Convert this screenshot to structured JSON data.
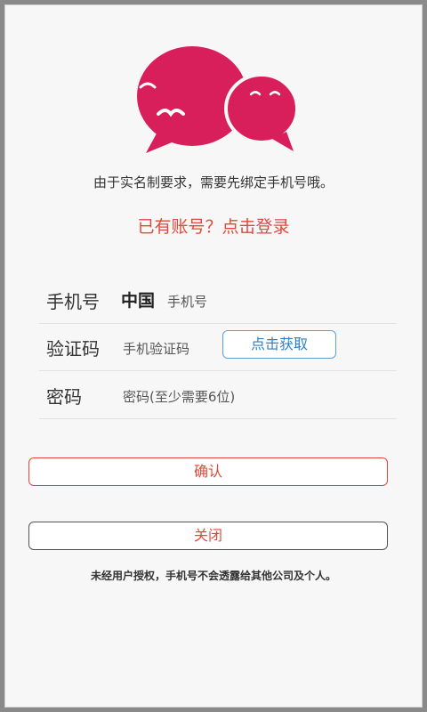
{
  "notice": "由于实名制要求，需要先绑定手机号哦。",
  "login_link": "已有账号？点击登录",
  "form": {
    "phone": {
      "label": "手机号",
      "country": "中国",
      "placeholder": "手机号"
    },
    "code": {
      "label": "验证码",
      "placeholder": "手机验证码",
      "button": "点击获取"
    },
    "password": {
      "label": "密码",
      "placeholder": "密码(至少需要6位)"
    }
  },
  "buttons": {
    "confirm": "确认",
    "close": "关闭"
  },
  "footnote": "未经用户授权，手机号不会透露给其他公司及个人。",
  "colors": {
    "brand": "#d81e5b",
    "accent_red": "#e0483b",
    "link_blue": "#2f7fc4"
  },
  "icons": {
    "logo": "chat-bubbles-logo-icon"
  }
}
